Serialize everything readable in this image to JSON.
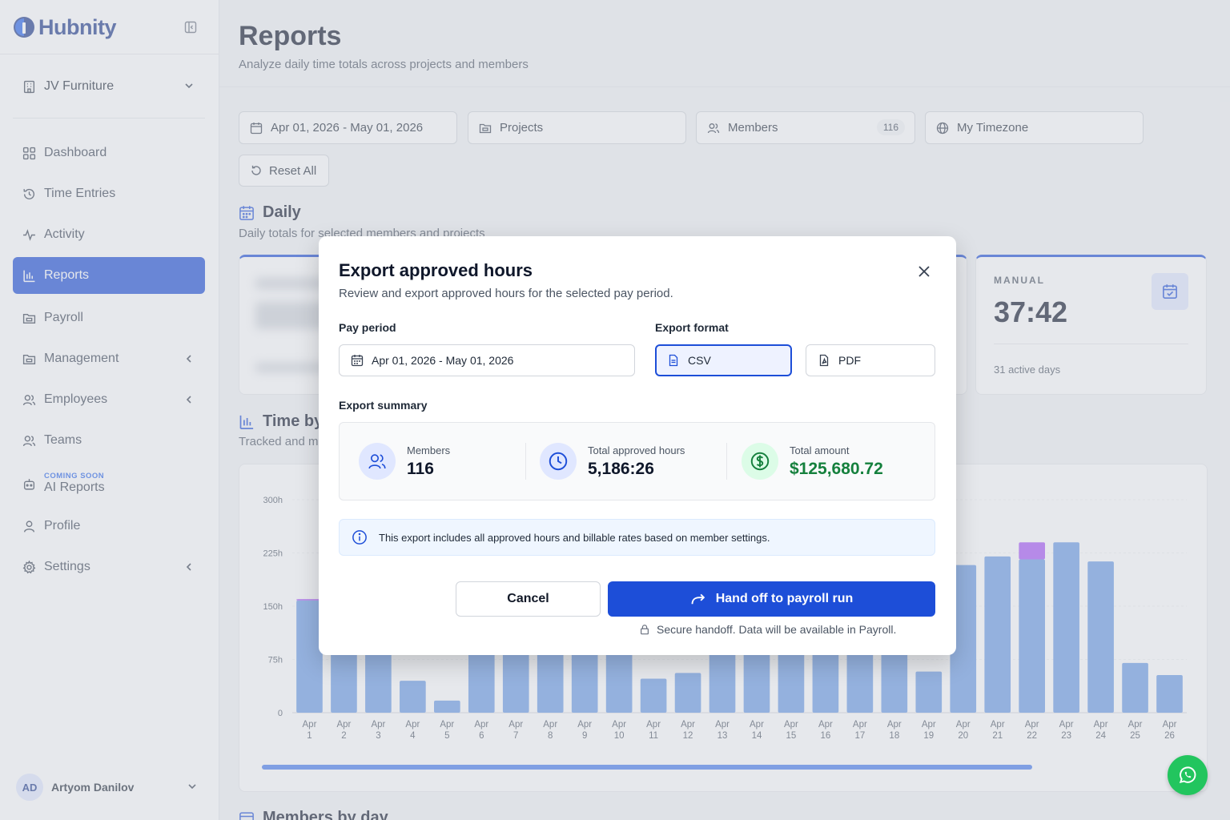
{
  "app": {
    "name": "Hubnity"
  },
  "sidebar": {
    "org_name": "JV Furniture",
    "items": [
      {
        "label": "Dashboard"
      },
      {
        "label": "Time Entries"
      },
      {
        "label": "Activity"
      },
      {
        "label": "Reports"
      },
      {
        "label": "Payroll"
      },
      {
        "label": "Management"
      },
      {
        "label": "Employees"
      },
      {
        "label": "Teams"
      },
      {
        "label": "AI Reports",
        "badge": "COMING SOON"
      },
      {
        "label": "Profile"
      },
      {
        "label": "Settings"
      }
    ],
    "active": "Reports",
    "user": {
      "initials": "AD",
      "name": "Artyom Danilov"
    }
  },
  "header": {
    "title": "Reports",
    "subtitle": "Analyze daily time totals across projects and members"
  },
  "filters": {
    "date_range": "Apr 01, 2026 - May 01, 2026",
    "projects": "Projects",
    "members": "Members",
    "members_count": "116",
    "timezone": "My Timezone",
    "reset": "Reset All"
  },
  "daily": {
    "title": "Daily",
    "subtitle": "Daily totals for selected members and projects",
    "manual_label": "MANUAL",
    "manual_value": "37:42",
    "manual_days": "31 active days"
  },
  "time_by": {
    "title": "Time by",
    "subtitle": "Tracked and m"
  },
  "members_by_day": {
    "title": "Members by day"
  },
  "chart_data": {
    "type": "bar",
    "categories": [
      "Apr 1",
      "Apr 2",
      "Apr 3",
      "Apr 4",
      "Apr 5",
      "Apr 6",
      "Apr 7",
      "Apr 8",
      "Apr 9",
      "Apr 10",
      "Apr 11",
      "Apr 12",
      "Apr 13",
      "Apr 14",
      "Apr 15",
      "Apr 16",
      "Apr 17",
      "Apr 18",
      "Apr 19",
      "Apr 20",
      "Apr 21",
      "Apr 22",
      "Apr 23",
      "Apr 24",
      "Apr 25",
      "Apr 26"
    ],
    "series": [
      {
        "values": [
          158,
          170,
          168,
          45,
          17,
          160,
          162,
          165,
          167,
          163,
          48,
          56,
          160,
          165,
          168,
          170,
          172,
          174,
          58,
          208,
          220,
          216,
          240,
          213,
          70,
          53
        ],
        "color": "#6b9be6"
      },
      {
        "values": [
          2,
          0,
          0,
          0,
          0,
          0,
          0,
          0,
          0,
          0,
          0,
          0,
          0,
          0,
          0,
          0,
          0,
          0,
          0,
          0,
          0,
          24,
          0,
          0,
          0,
          0
        ],
        "color": "#a855f7"
      }
    ],
    "yticks": [
      "0",
      "75h",
      "150h",
      "225h",
      "300h"
    ],
    "ylim": [
      0,
      300
    ]
  },
  "modal": {
    "title": "Export approved hours",
    "subtitle": "Review and export approved hours for the selected pay period.",
    "pay_period_label": "Pay period",
    "pay_period_value": "Apr 01, 2026 - May 01, 2026",
    "export_format_label": "Export format",
    "formats": [
      "CSV",
      "PDF"
    ],
    "selected_format": "CSV",
    "summary_label": "Export summary",
    "summary": {
      "members_label": "Members",
      "members_value": "116",
      "hours_label": "Total approved hours",
      "hours_value": "5,186:26",
      "amount_label": "Total amount",
      "amount_value": "$125,680.72"
    },
    "info": "This export includes all approved hours and billable rates based on member settings.",
    "cancel": "Cancel",
    "primary": "Hand off to payroll run",
    "secure_note": "Secure handoff. Data will be available in Payroll."
  }
}
